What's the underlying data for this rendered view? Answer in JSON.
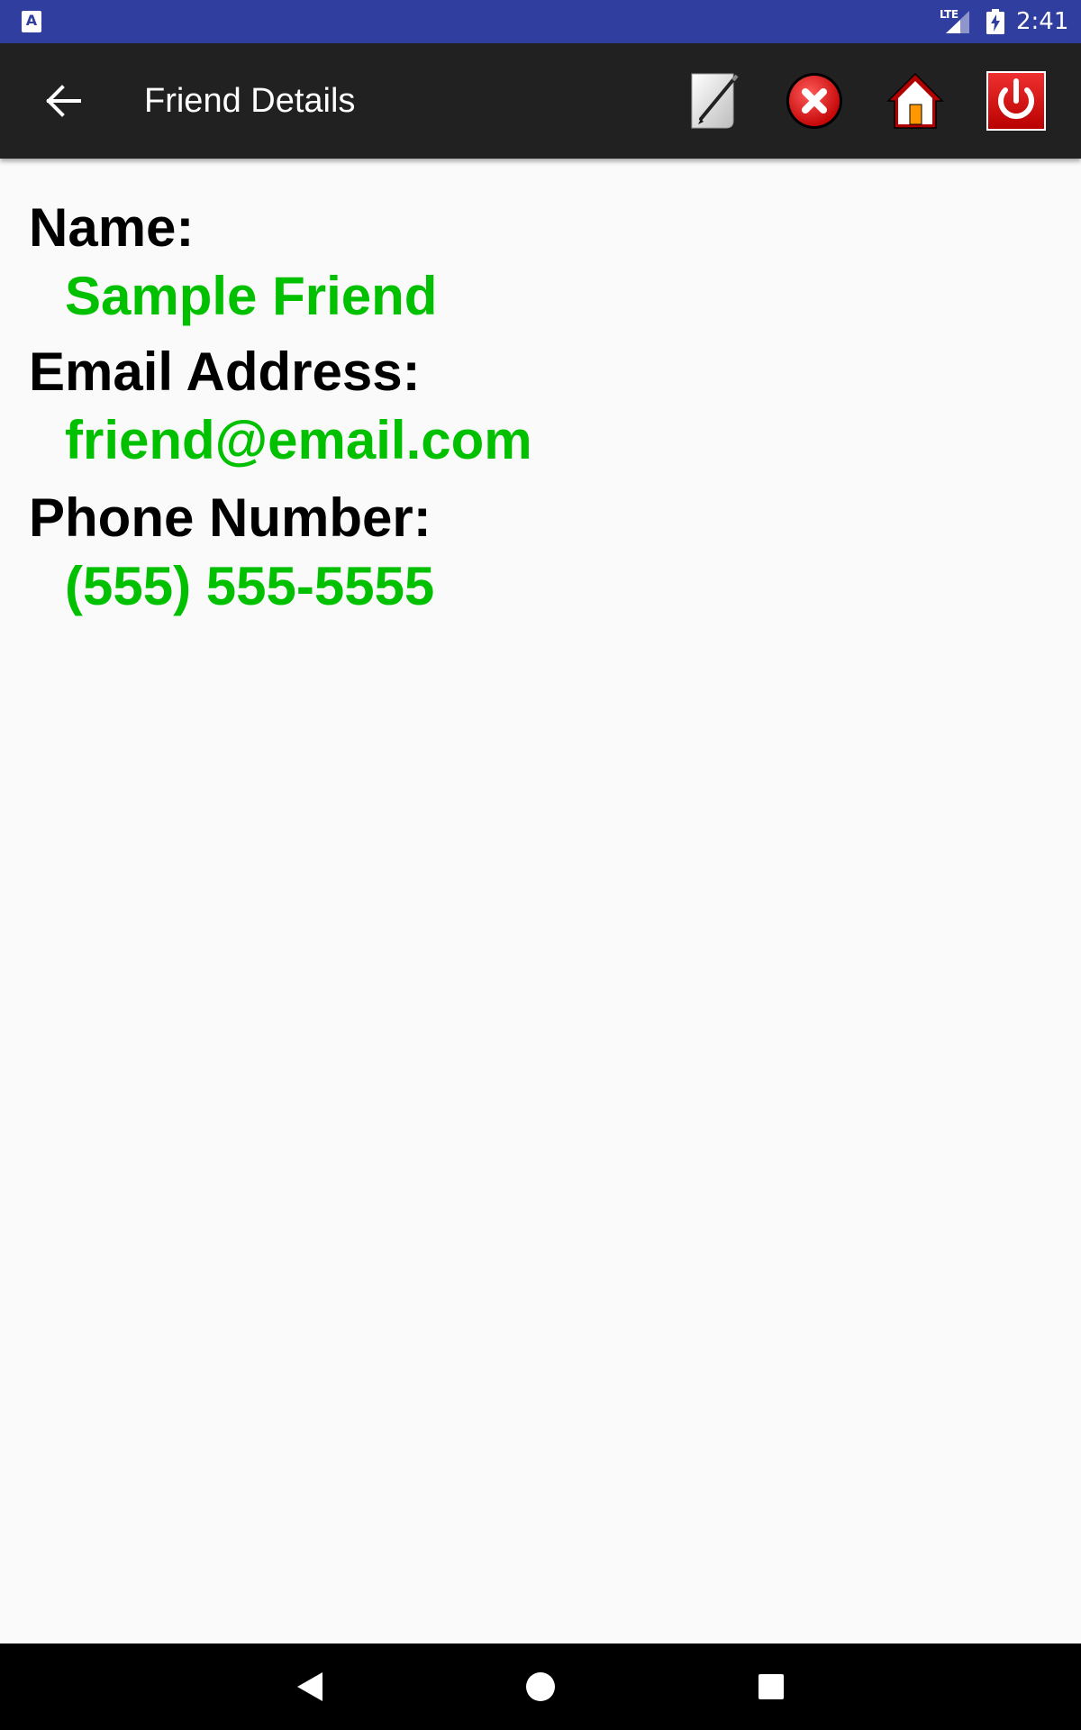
{
  "status_bar": {
    "app_icon_letter": "A",
    "network": "LTE",
    "time": "2:41",
    "color": "#303f9f"
  },
  "toolbar": {
    "title": "Friend Details",
    "background": "#212121",
    "actions": [
      {
        "name": "edit",
        "icon": "edit-pencil-icon"
      },
      {
        "name": "delete",
        "icon": "delete-x-icon"
      },
      {
        "name": "home",
        "icon": "home-icon"
      },
      {
        "name": "power",
        "icon": "power-icon"
      }
    ]
  },
  "details": {
    "name_label": "Name:",
    "name_value": "Sample Friend",
    "email_label": "Email Address:",
    "email_value": "friend@email.com",
    "phone_label": "Phone Number:",
    "phone_value": "(555) 555-5555",
    "label_color": "#000000",
    "value_color": "#00c000"
  },
  "nav_bar": {
    "buttons": [
      "back-triangle-icon",
      "home-circle-icon",
      "recents-square-icon"
    ]
  }
}
